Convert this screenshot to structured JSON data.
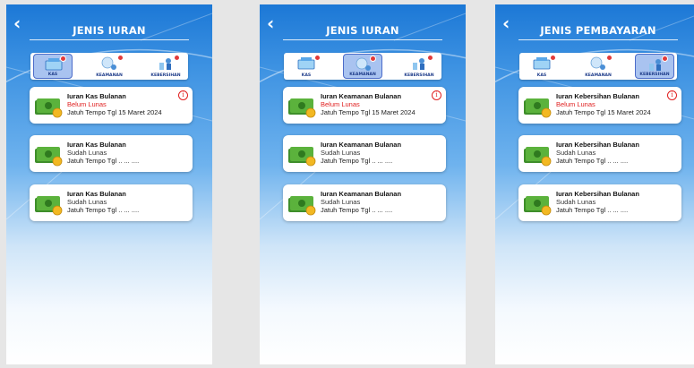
{
  "accent_color": "#1c78d6",
  "unpaid_color": "#e02020",
  "screens": [
    {
      "title": "JENIS IURAN",
      "tabs": [
        {
          "label": "KAS",
          "icon": "cash-register-icon",
          "active": true
        },
        {
          "label": "KEAMANAN",
          "icon": "security-icon",
          "active": false
        },
        {
          "label": "KEBERSIHAN",
          "icon": "cleaning-icon",
          "active": false
        }
      ],
      "cards": [
        {
          "title": "Iuran Kas Bulanan",
          "status": "Belum Lunas",
          "due": "Jatuh Tempo Tgl 15 Maret 2024",
          "info": "i"
        },
        {
          "title": "Iuran Kas Bulanan",
          "status": "Sudah Lunas",
          "due": "Jatuh Tempo Tgl .. ... ...."
        },
        {
          "title": "Iuran Kas Bulanan",
          "status": "Sudah Lunas",
          "due": "Jatuh Tempo Tgl .. ... ...."
        }
      ]
    },
    {
      "title": "JENIS IURAN",
      "tabs": [
        {
          "label": "KAS",
          "icon": "cash-register-icon",
          "active": false
        },
        {
          "label": "KEAMANAN",
          "icon": "security-icon",
          "active": true
        },
        {
          "label": "KEBERSIHAN",
          "icon": "cleaning-icon",
          "active": false
        }
      ],
      "cards": [
        {
          "title": "Iuran Keamanan Bulanan",
          "status": "Belum Lunas",
          "due": "Jatuh Tempo Tgl 15 Maret 2024",
          "info": "i"
        },
        {
          "title": "Iuran Keamanan Bulanan",
          "status": "Sudah Lunas",
          "due": "Jatuh Tempo Tgl .. ... ...."
        },
        {
          "title": "Iuran Keamanan Bulanan",
          "status": "Sudah Lunas",
          "due": "Jatuh Tempo Tgl .. ... ...."
        }
      ]
    },
    {
      "title": "JENIS PEMBAYARAN",
      "tabs": [
        {
          "label": "KAS",
          "icon": "cash-register-icon",
          "active": false
        },
        {
          "label": "KEAMANAN",
          "icon": "security-icon",
          "active": false
        },
        {
          "label": "KEBERSIHAN",
          "icon": "cleaning-icon",
          "active": true
        }
      ],
      "cards": [
        {
          "title": "Iuran Kebersihan Bulanan",
          "status": "Belum Lunas",
          "due": "Jatuh Tempo Tgl 15 Maret 2024",
          "info": "i"
        },
        {
          "title": "Iuran Kebersihan Bulanan",
          "status": "Sudah Lunas",
          "due": "Jatuh Tempo Tgl .. ... ...."
        },
        {
          "title": "Iuran Kebersihan Bulanan",
          "status": "Sudah Lunas",
          "due": "Jatuh Tempo Tgl .. ... ...."
        }
      ]
    }
  ]
}
